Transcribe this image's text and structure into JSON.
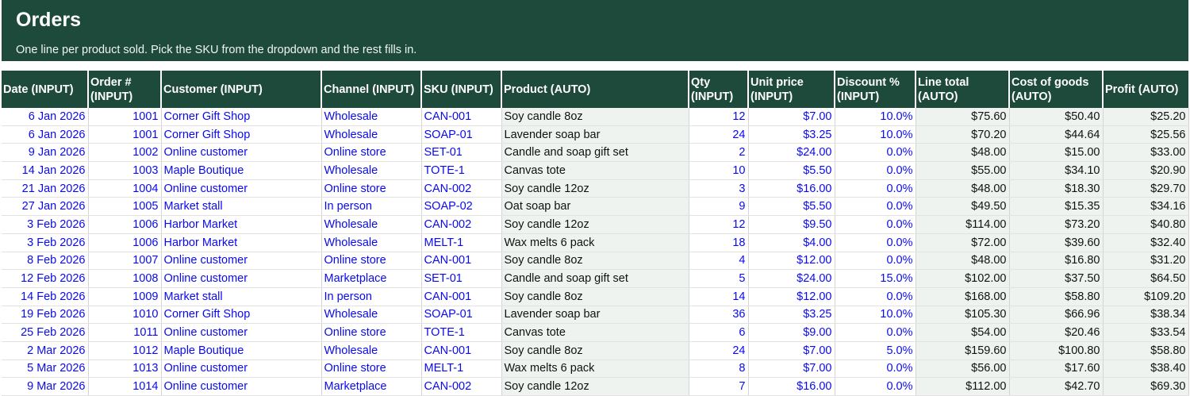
{
  "sheet": {
    "title": "Orders",
    "subtitle": "One line per product sold. Pick the SKU from the dropdown and the rest fills in."
  },
  "colors": {
    "header_bg": "#1e4a3c",
    "input_text": "#0a0af0",
    "auto_fill": "#eef3f0"
  },
  "table": {
    "headers": {
      "date": "Date (INPUT)",
      "order_1": "Order #",
      "order_2": "(INPUT)",
      "customer": "Customer (INPUT)",
      "channel": "Channel (INPUT)",
      "sku": "SKU (INPUT)",
      "product": "Product (AUTO)",
      "qty_1": "Qty",
      "qty_2": "(INPUT)",
      "unit_1": "Unit price",
      "unit_2": "(INPUT)",
      "disc_1": "Discount %",
      "disc_2": "(INPUT)",
      "line_1": "Line total",
      "line_2": "(AUTO)",
      "cogs_1": "Cost of goods",
      "cogs_2": "(AUTO)",
      "profit": "Profit (AUTO)"
    },
    "rows": [
      {
        "date": "6 Jan 2026",
        "order": "1001",
        "customer": "Corner Gift Shop",
        "channel": "Wholesale",
        "sku": "CAN-001",
        "product": "Soy candle 8oz",
        "qty": "12",
        "unit_price": "$7.00",
        "discount": "10.0%",
        "line_total": "$75.60",
        "cogs": "$50.40",
        "profit": "$25.20"
      },
      {
        "date": "6 Jan 2026",
        "order": "1001",
        "customer": "Corner Gift Shop",
        "channel": "Wholesale",
        "sku": "SOAP-01",
        "product": "Lavender soap bar",
        "qty": "24",
        "unit_price": "$3.25",
        "discount": "10.0%",
        "line_total": "$70.20",
        "cogs": "$44.64",
        "profit": "$25.56"
      },
      {
        "date": "9 Jan 2026",
        "order": "1002",
        "customer": "Online customer",
        "channel": "Online store",
        "sku": "SET-01",
        "product": "Candle and soap gift set",
        "qty": "2",
        "unit_price": "$24.00",
        "discount": "0.0%",
        "line_total": "$48.00",
        "cogs": "$15.00",
        "profit": "$33.00"
      },
      {
        "date": "14 Jan 2026",
        "order": "1003",
        "customer": "Maple Boutique",
        "channel": "Wholesale",
        "sku": "TOTE-1",
        "product": "Canvas tote",
        "qty": "10",
        "unit_price": "$5.50",
        "discount": "0.0%",
        "line_total": "$55.00",
        "cogs": "$34.10",
        "profit": "$20.90"
      },
      {
        "date": "21 Jan 2026",
        "order": "1004",
        "customer": "Online customer",
        "channel": "Online store",
        "sku": "CAN-002",
        "product": "Soy candle 12oz",
        "qty": "3",
        "unit_price": "$16.00",
        "discount": "0.0%",
        "line_total": "$48.00",
        "cogs": "$18.30",
        "profit": "$29.70"
      },
      {
        "date": "27 Jan 2026",
        "order": "1005",
        "customer": "Market stall",
        "channel": "In person",
        "sku": "SOAP-02",
        "product": "Oat soap bar",
        "qty": "9",
        "unit_price": "$5.50",
        "discount": "0.0%",
        "line_total": "$49.50",
        "cogs": "$15.35",
        "profit": "$34.16"
      },
      {
        "date": "3 Feb 2026",
        "order": "1006",
        "customer": "Harbor Market",
        "channel": "Wholesale",
        "sku": "CAN-002",
        "product": "Soy candle 12oz",
        "qty": "12",
        "unit_price": "$9.50",
        "discount": "0.0%",
        "line_total": "$114.00",
        "cogs": "$73.20",
        "profit": "$40.80"
      },
      {
        "date": "3 Feb 2026",
        "order": "1006",
        "customer": "Harbor Market",
        "channel": "Wholesale",
        "sku": "MELT-1",
        "product": "Wax melts 6 pack",
        "qty": "18",
        "unit_price": "$4.00",
        "discount": "0.0%",
        "line_total": "$72.00",
        "cogs": "$39.60",
        "profit": "$32.40"
      },
      {
        "date": "8 Feb 2026",
        "order": "1007",
        "customer": "Online customer",
        "channel": "Online store",
        "sku": "CAN-001",
        "product": "Soy candle 8oz",
        "qty": "4",
        "unit_price": "$12.00",
        "discount": "0.0%",
        "line_total": "$48.00",
        "cogs": "$16.80",
        "profit": "$31.20"
      },
      {
        "date": "12 Feb 2026",
        "order": "1008",
        "customer": "Online customer",
        "channel": "Marketplace",
        "sku": "SET-01",
        "product": "Candle and soap gift set",
        "qty": "5",
        "unit_price": "$24.00",
        "discount": "15.0%",
        "line_total": "$102.00",
        "cogs": "$37.50",
        "profit": "$64.50"
      },
      {
        "date": "14 Feb 2026",
        "order": "1009",
        "customer": "Market stall",
        "channel": "In person",
        "sku": "CAN-001",
        "product": "Soy candle 8oz",
        "qty": "14",
        "unit_price": "$12.00",
        "discount": "0.0%",
        "line_total": "$168.00",
        "cogs": "$58.80",
        "profit": "$109.20"
      },
      {
        "date": "19 Feb 2026",
        "order": "1010",
        "customer": "Corner Gift Shop",
        "channel": "Wholesale",
        "sku": "SOAP-01",
        "product": "Lavender soap bar",
        "qty": "36",
        "unit_price": "$3.25",
        "discount": "10.0%",
        "line_total": "$105.30",
        "cogs": "$66.96",
        "profit": "$38.34"
      },
      {
        "date": "25 Feb 2026",
        "order": "1011",
        "customer": "Online customer",
        "channel": "Online store",
        "sku": "TOTE-1",
        "product": "Canvas tote",
        "qty": "6",
        "unit_price": "$9.00",
        "discount": "0.0%",
        "line_total": "$54.00",
        "cogs": "$20.46",
        "profit": "$33.54"
      },
      {
        "date": "2 Mar 2026",
        "order": "1012",
        "customer": "Maple Boutique",
        "channel": "Wholesale",
        "sku": "CAN-001",
        "product": "Soy candle 8oz",
        "qty": "24",
        "unit_price": "$7.00",
        "discount": "5.0%",
        "line_total": "$159.60",
        "cogs": "$100.80",
        "profit": "$58.80"
      },
      {
        "date": "5 Mar 2026",
        "order": "1013",
        "customer": "Online customer",
        "channel": "Online store",
        "sku": "MELT-1",
        "product": "Wax melts 6 pack",
        "qty": "8",
        "unit_price": "$7.00",
        "discount": "0.0%",
        "line_total": "$56.00",
        "cogs": "$17.60",
        "profit": "$38.40"
      },
      {
        "date": "9 Mar 2026",
        "order": "1014",
        "customer": "Online customer",
        "channel": "Marketplace",
        "sku": "CAN-002",
        "product": "Soy candle 12oz",
        "qty": "7",
        "unit_price": "$16.00",
        "discount": "0.0%",
        "line_total": "$112.00",
        "cogs": "$42.70",
        "profit": "$69.30"
      }
    ]
  }
}
